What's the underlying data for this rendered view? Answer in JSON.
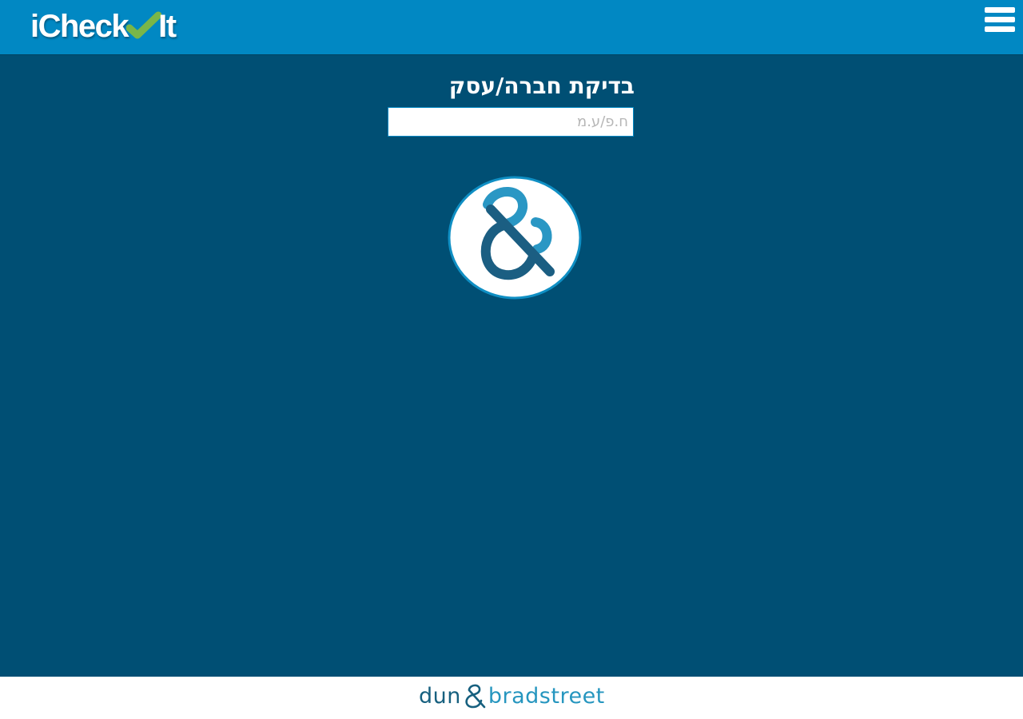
{
  "header": {
    "logo_prefix": "iCheck",
    "logo_suffix": "It",
    "menu_icon": "hamburger-menu-icon"
  },
  "main": {
    "title": "בדיקת חברה/עסק",
    "input": {
      "placeholder": "ח.פ/ע.מ",
      "value": ""
    },
    "brand_icon": "ampersand-logo-icon"
  },
  "footer": {
    "brand_left": "dun",
    "brand_right": "bradstreet",
    "amp_icon": "ampersand-icon"
  },
  "colors": {
    "header_bg": "#0188c3",
    "page_bg": "#004f74",
    "check_green": "#7ab648",
    "brand_dark": "#17607f",
    "brand_light": "#2696bf",
    "footer_bg": "#ffffff"
  }
}
